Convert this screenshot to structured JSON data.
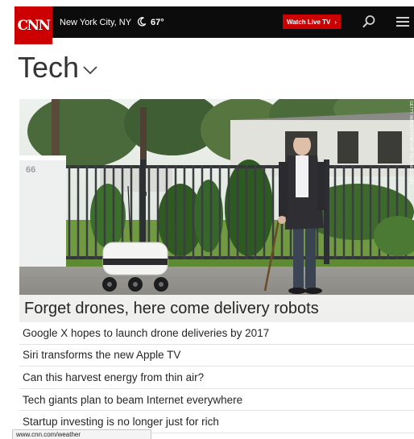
{
  "header": {
    "logo_text": "CNN",
    "location": "New York City, NY",
    "temperature": "67°",
    "weather_icon": "crescent-moon-icon",
    "watch_live_label": "Watch Live TV",
    "watch_live_chevron": "›",
    "search_icon": "search-icon",
    "menu_icon": "hamburger-menu-icon",
    "brand_color": "#cc0000"
  },
  "section": {
    "title": "Tech",
    "dropdown_icon": "chevron-down-icon"
  },
  "hero": {
    "headline": "Forget drones, here come delivery robots",
    "building_number": "66",
    "photo_credit": "GETTY IMAGES/STARSHIP TECHNOLOGIES"
  },
  "headlines": [
    "Google X hopes to launch drone deliveries by 2017",
    "Siri transforms the new Apple TV",
    "Can this harvest energy from thin air?",
    "Tech giants plan to beam Internet everywhere",
    "Startup investing is no longer just for rich"
  ],
  "status_bar": {
    "url": "www.cnn.com/weather"
  }
}
